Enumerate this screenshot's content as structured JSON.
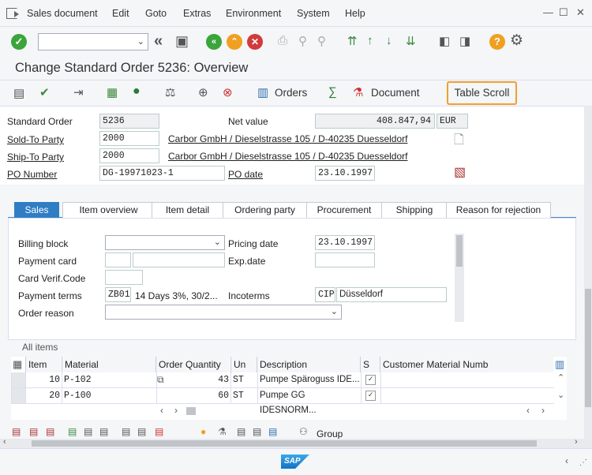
{
  "menu": {
    "items": [
      "Sales document",
      "Edit",
      "Goto",
      "Extras",
      "Environment",
      "System",
      "Help"
    ]
  },
  "window": {
    "title": "Change Standard Order 5236: Overview"
  },
  "app_toolbar": {
    "orders_label": "Orders",
    "document_label": "Document",
    "table_scroll_label": "Table Scroll"
  },
  "header_fields": {
    "standard_order_label": "Standard Order",
    "standard_order_value": "5236",
    "net_value_label": "Net value",
    "net_value_value": "408.847,94",
    "currency": "EUR",
    "sold_to_label": "Sold-To Party",
    "sold_to_value": "2000",
    "sold_to_desc": "Carbor GmbH / Dieselstrasse 105 / D-40235 Duesseldorf",
    "ship_to_label": "Ship-To Party",
    "ship_to_value": "2000",
    "ship_to_desc": "Carbor GmbH / Dieselstrasse 105 / D-40235 Duesseldorf",
    "po_number_label": "PO Number",
    "po_number_value": "DG-19971023-1",
    "po_date_label": "PO date",
    "po_date_value": "23.10.1997"
  },
  "tabs": [
    "Sales",
    "Item overview",
    "Item detail",
    "Ordering party",
    "Procurement",
    "Shipping",
    "Reason for rejection"
  ],
  "sales_tab": {
    "billing_block_label": "Billing block",
    "billing_block_value": "",
    "pricing_date_label": "Pricing date",
    "pricing_date_value": "23.10.1997",
    "payment_card_label": "Payment card",
    "exp_date_label": "Exp.date",
    "card_verif_label": "Card Verif.Code",
    "payment_terms_label": "Payment terms",
    "payment_terms_code": "ZB01",
    "payment_terms_desc": "14 Days 3%, 30/2...",
    "incoterms_label": "Incoterms",
    "incoterms_code": "CIP",
    "incoterms_place": "Düsseldorf",
    "order_reason_label": "Order reason"
  },
  "items": {
    "section_title": "All items",
    "columns": [
      "Item",
      "Material",
      "Order Quantity",
      "Un",
      "Description",
      "S",
      "Customer Material Numb"
    ],
    "rows": [
      {
        "item": "10",
        "material": "P-102",
        "qty": "43",
        "unit": "ST",
        "description": "Pumpe Späroguss IDE...",
        "s": "✓"
      },
      {
        "item": "20",
        "material": "P-100",
        "qty": "60",
        "unit": "ST",
        "description": "Pumpe GG IDESNORM...",
        "s": "✓"
      }
    ],
    "group_label": "Group"
  },
  "colors": {
    "accent_blue": "#2f7dc5",
    "highlight_orange": "#f0a030",
    "ok_green": "#3aa53a",
    "cancel_red": "#d23b3b",
    "warn_orange": "#f0a020"
  }
}
